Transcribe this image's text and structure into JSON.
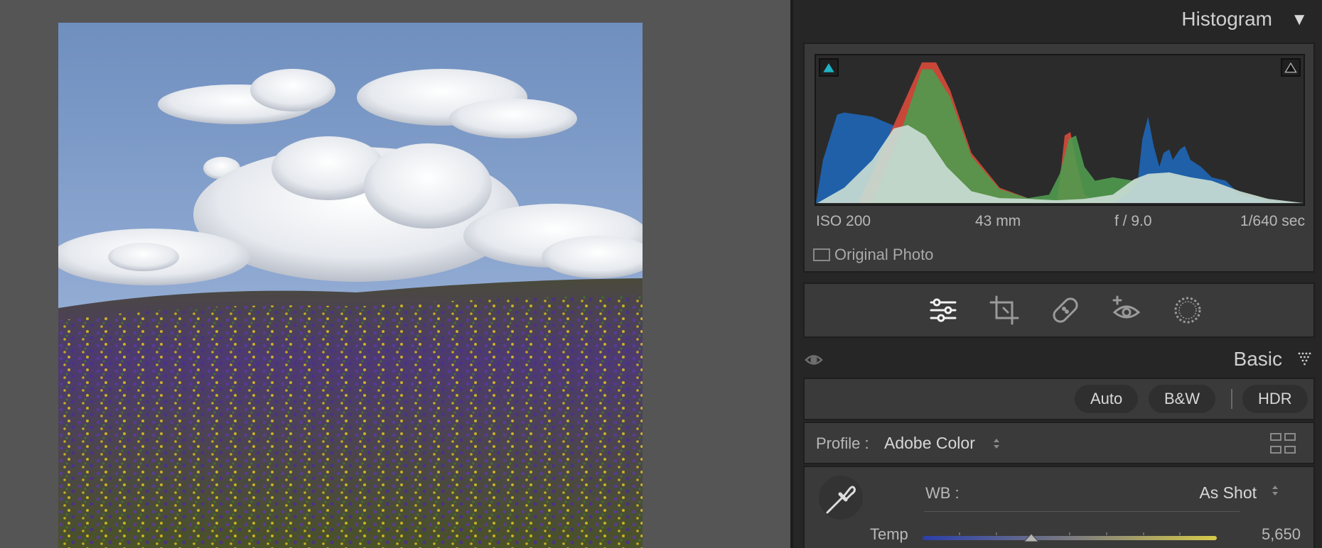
{
  "histogram": {
    "title": "Histogram",
    "exif": {
      "iso": "ISO 200",
      "focal": "43 mm",
      "aperture": "f / 9.0",
      "shutter": "1/640 sec"
    },
    "original_photo_label": "Original Photo"
  },
  "tools": [
    "edit-sliders",
    "crop",
    "healing",
    "red-eye",
    "masking"
  ],
  "basic": {
    "title": "Basic",
    "auto_label": "Auto",
    "bw_label": "B&W",
    "hdr_label": "HDR",
    "profile_label": "Profile :",
    "profile_value": "Adobe Color",
    "wb_label": "WB :",
    "wb_value": "As Shot",
    "temp_label": "Temp",
    "temp_value": "5,650"
  },
  "colors": {
    "panel": "#262626",
    "section": "#3a3a3a",
    "clip_shadow": "#1fb3c4"
  }
}
